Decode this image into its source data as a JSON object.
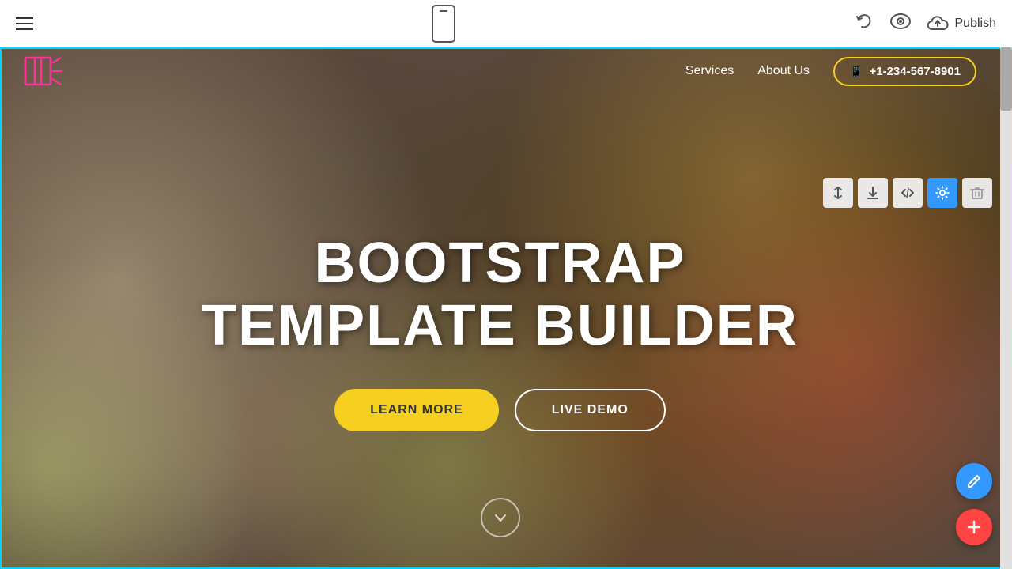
{
  "toolbar": {
    "menu_label": "Menu",
    "undo_label": "Undo",
    "preview_label": "Preview",
    "publish_label": "Publish"
  },
  "site": {
    "nav": {
      "services_label": "Services",
      "about_us_label": "About Us",
      "phone": "+1-234-567-8901"
    },
    "hero": {
      "title_line1": "BOOTSTRAP",
      "title_line2": "TEMPLATE BUILDER",
      "learn_more_label": "LEARN MORE",
      "live_demo_label": "LIVE DEMO"
    }
  },
  "block_toolbar": {
    "move_icon": "⇅",
    "download_icon": "⬇",
    "code_icon": "</>",
    "settings_icon": "⚙",
    "delete_icon": "🗑"
  },
  "fabs": {
    "edit_icon": "✏",
    "add_icon": "+"
  },
  "colors": {
    "accent": "#f5d020",
    "cyan": "#00d4ff",
    "blue": "#3399ff",
    "red": "#ff4444"
  }
}
